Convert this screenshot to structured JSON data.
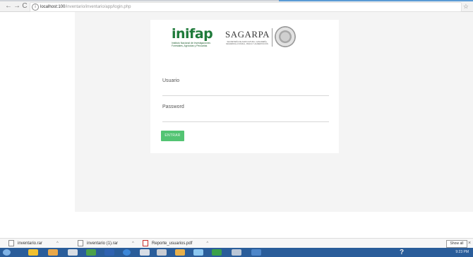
{
  "browser": {
    "back_glyph": "←",
    "forward_glyph": "→",
    "reload_glyph": "C",
    "url_host": "localhost:100",
    "url_path": "/inventario/inventario/app/login.php",
    "info_icon": "info-icon",
    "bookmark_glyph": "☆"
  },
  "login": {
    "inifap_word": "inifap",
    "inifap_tagline": "Instituto Nacional de Investigaciones Forestales, Agrícolas y Pecuarias",
    "sagarpa_word": "SAGARPA",
    "sagarpa_tagline": "SECRETARÍA DE AGRICULTURA, GANADERÍA, DESARROLLO RURAL, PESCA Y ALIMENTACIÓN",
    "usuario_label": "Usuario",
    "password_label": "Password",
    "submit_label": "ENTRAR",
    "accent_color": "#53c473"
  },
  "downloads": {
    "items": [
      {
        "name": "inventario.rar",
        "chevron": "^"
      },
      {
        "name": "inventario (1).rar",
        "chevron": "^"
      },
      {
        "name": "Reporte_usuarios.pdf",
        "chevron": "^"
      }
    ],
    "show_all": "Show all",
    "close_glyph": "×"
  },
  "taskbar": {
    "help_glyph": "?",
    "clock": "9:23 PM",
    "color": "#2a5d9a"
  }
}
